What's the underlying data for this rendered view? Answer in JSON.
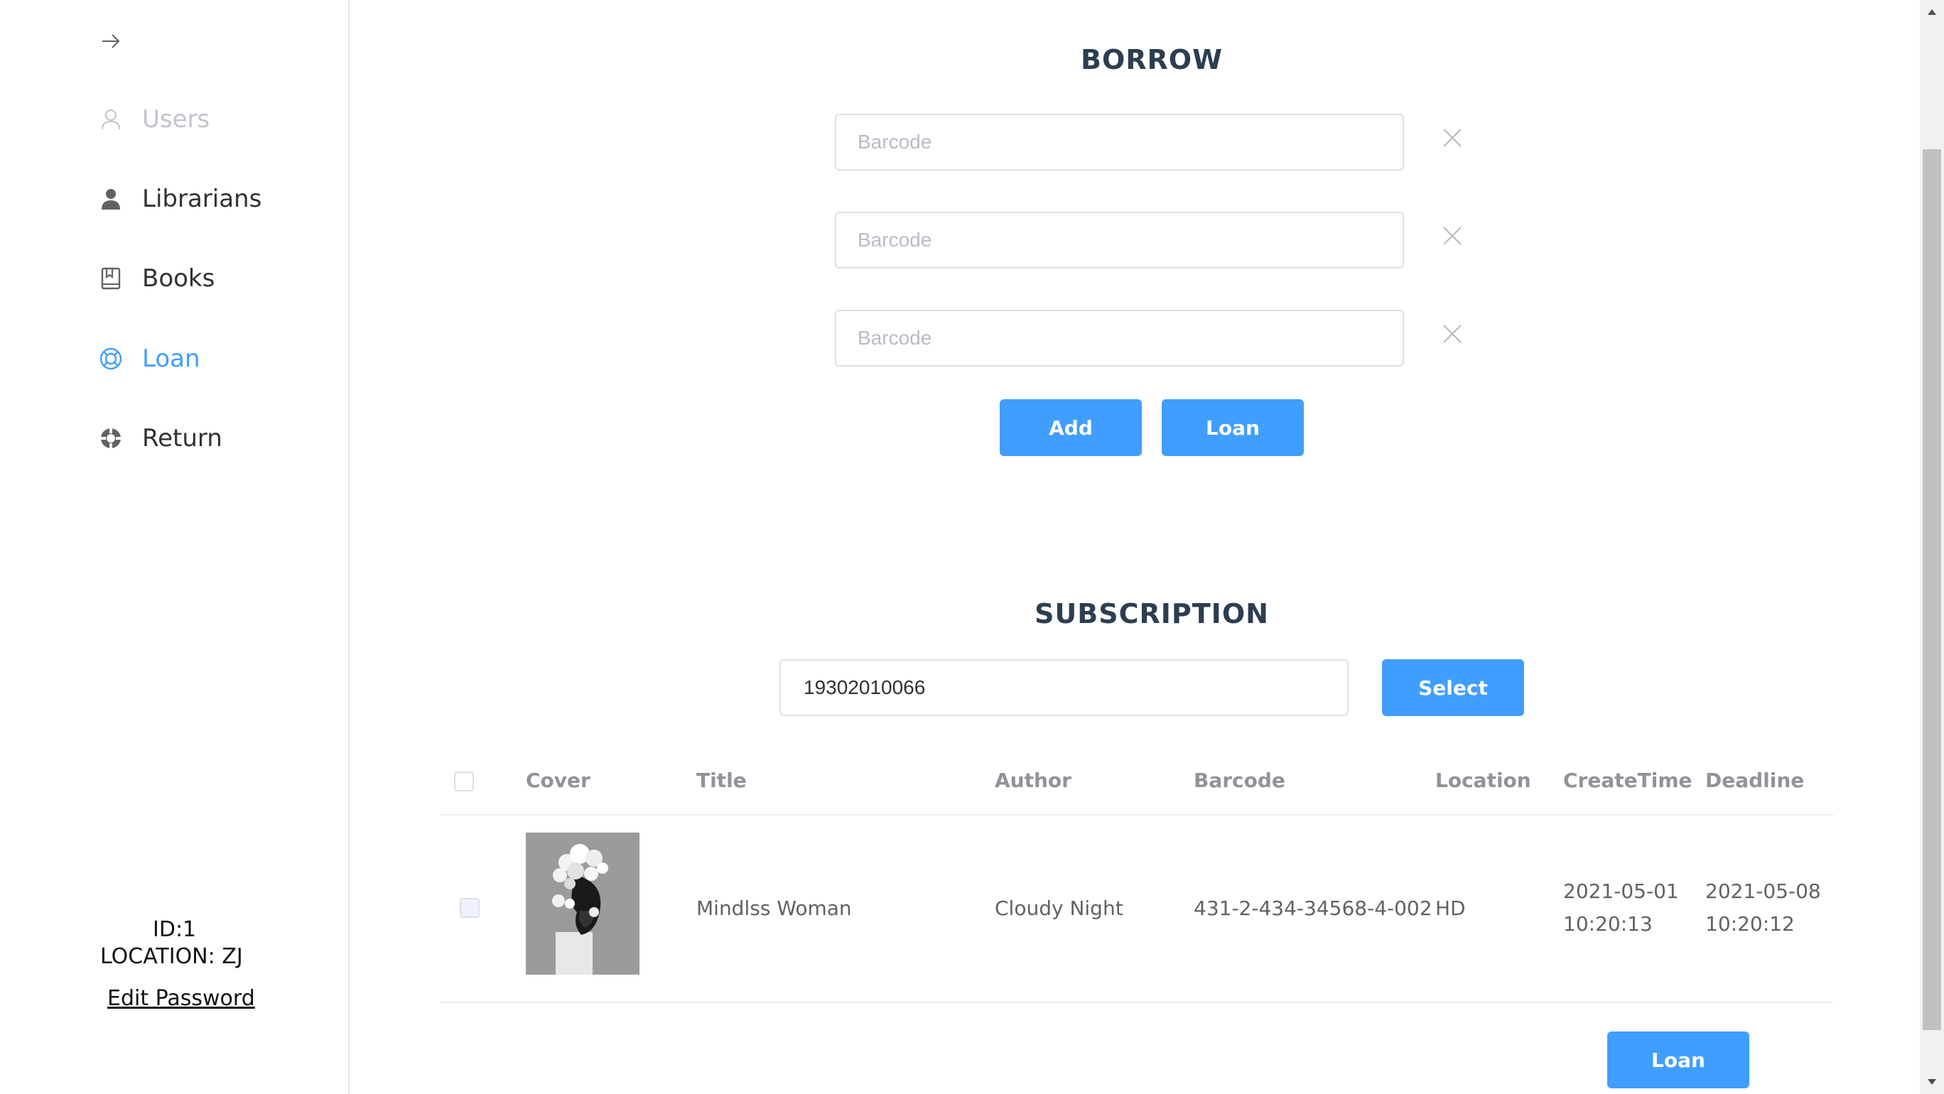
{
  "sidebar": {
    "items": [
      {
        "label": "Users",
        "icon": "user-outline-icon",
        "state": "disabled"
      },
      {
        "label": "Librarians",
        "icon": "user-filled-icon",
        "state": "normal"
      },
      {
        "label": "Books",
        "icon": "book-icon",
        "state": "normal"
      },
      {
        "label": "Loan",
        "icon": "lifebuoy-icon",
        "state": "active"
      },
      {
        "label": "Return",
        "icon": "return-icon",
        "state": "normal"
      }
    ],
    "user": {
      "id_text": "ID:1",
      "location_text": "LOCATION: ZJ",
      "edit_password": "Edit Password"
    }
  },
  "borrow": {
    "title": "BORROW",
    "barcode_placeholder": "Barcode",
    "inputs": [
      "",
      "",
      ""
    ],
    "add_label": "Add",
    "loan_label": "Loan"
  },
  "subscription": {
    "title": "SUBSCRIPTION",
    "search_value": "19302010066",
    "select_label": "Select",
    "columns": [
      "Cover",
      "Title",
      "Author",
      "Barcode",
      "Location",
      "CreateTime",
      "Deadline"
    ],
    "rows": [
      {
        "title": "Mindlss Woman",
        "author": "Cloudy Night",
        "barcode": "431-2-434-34568-4-002",
        "location": "HD",
        "create_date": "2021-05-01",
        "create_time": "10:20:13",
        "deadline_date": "2021-05-08",
        "deadline_time": "10:20:12"
      }
    ],
    "loan_label": "Loan"
  },
  "colors": {
    "accent": "#409eff",
    "disabled": "#c0c4cc",
    "title": "#2c3e50",
    "border": "#dcdfe6"
  }
}
